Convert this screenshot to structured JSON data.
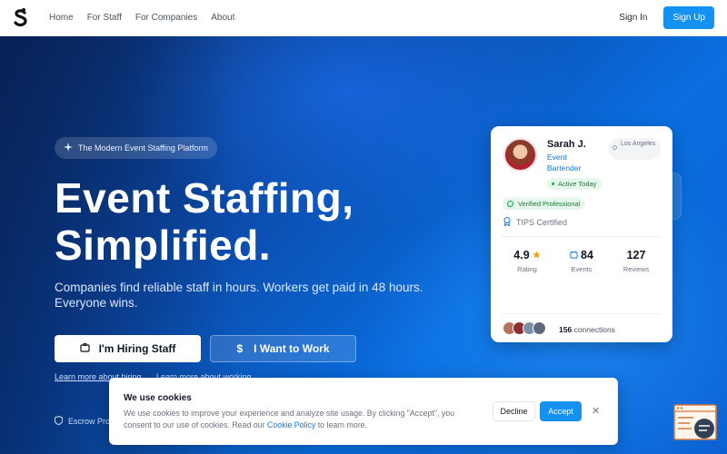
{
  "nav": {
    "logo_icon": "s-logo-icon",
    "links": [
      "Home",
      "For Staff",
      "For Companies",
      "About"
    ],
    "sign_in": "Sign In",
    "sign_up": "Sign Up"
  },
  "hero": {
    "pill": "The Modern Event Staffing Platform",
    "headline_1": "Event Staffing,",
    "headline_2": "Simplified.",
    "subtitle": "Companies find reliable staff in hours. Workers get paid in 48 hours. Everyone wins.",
    "hire_button": "I'm Hiring Staff",
    "work_button": "I Want to Work",
    "work_icon": "$",
    "learn_hiring": "Learn more about hiring",
    "learn_working": "Learn more about working",
    "escrow": "Escrow Pro"
  },
  "profile": {
    "name": "Sarah J.",
    "role": "Event Bartender",
    "location": "Los Angeles",
    "status": "Active Today",
    "verified": "Verified Professional",
    "certification": "TIPS Certified",
    "stats": [
      {
        "value": "4.9",
        "label": "Rating"
      },
      {
        "value": "84",
        "label": "Events"
      },
      {
        "value": "127",
        "label": "Reviews"
      }
    ],
    "connections_count": "156",
    "connections_label": "connections"
  },
  "cookie": {
    "title": "We use cookies",
    "text_before": "We use cookies to improve your experience and analyze site usage. By clicking \"Accept\", you consent to our use of cookies. Read our",
    "link": "Cookie Policy",
    "text_after": "to learn more.",
    "decline": "Decline",
    "accept": "Accept",
    "close": "✕"
  },
  "colors": {
    "accent": "#1591f2",
    "hero_dark": "#0b2a66",
    "hero_bright": "#0a6ee0"
  }
}
